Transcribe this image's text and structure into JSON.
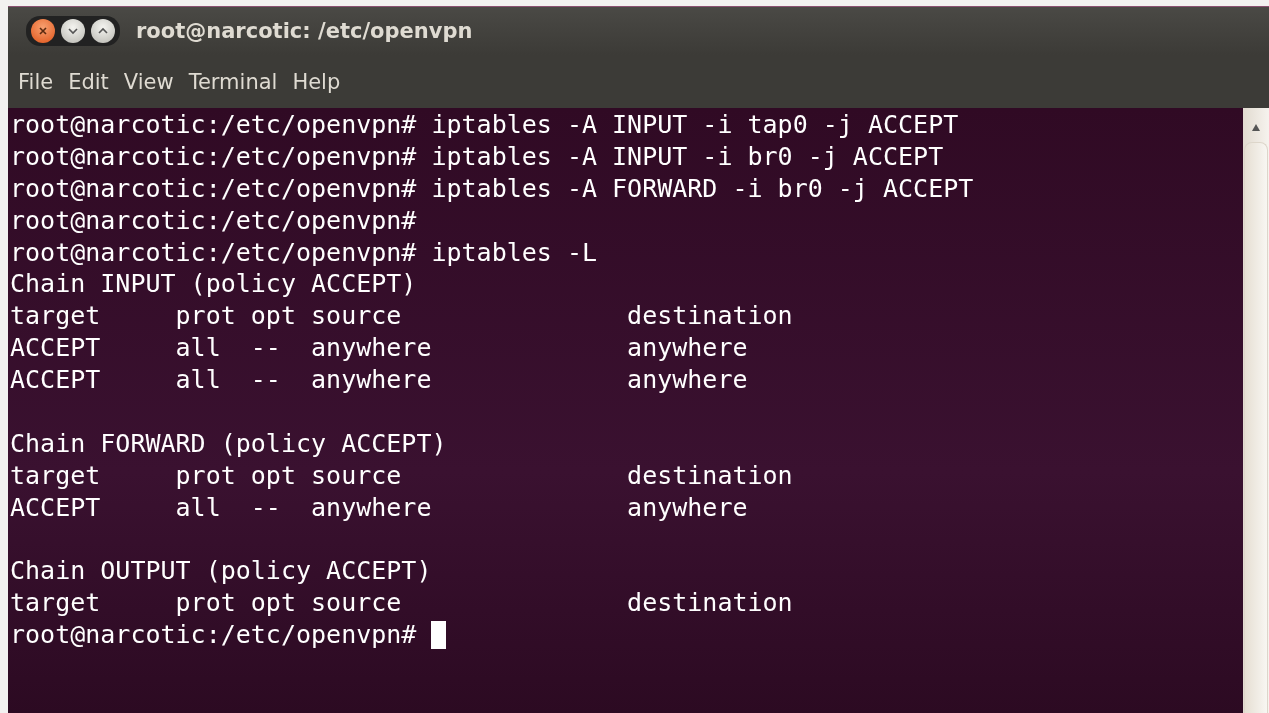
{
  "window": {
    "title": "root@narcotic: /etc/openvpn"
  },
  "menu": [
    "File",
    "Edit",
    "View",
    "Terminal",
    "Help"
  ],
  "terminal": {
    "lines": [
      {
        "kind": "text",
        "text": "root@narcotic:/etc/openvpn# iptables -A INPUT -i tap0 -j ACCEPT"
      },
      {
        "kind": "text",
        "text": "root@narcotic:/etc/openvpn# iptables -A INPUT -i br0 -j ACCEPT"
      },
      {
        "kind": "text",
        "text": "root@narcotic:/etc/openvpn# iptables -A FORWARD -i br0 -j ACCEPT"
      },
      {
        "kind": "text",
        "text": "root@narcotic:/etc/openvpn#"
      },
      {
        "kind": "text",
        "text": "root@narcotic:/etc/openvpn# iptables -L"
      },
      {
        "kind": "text",
        "text": "Chain INPUT (policy ACCEPT)"
      },
      {
        "kind": "text",
        "text": "target     prot opt source               destination"
      },
      {
        "kind": "text",
        "text": "ACCEPT     all  --  anywhere             anywhere"
      },
      {
        "kind": "text",
        "text": "ACCEPT     all  --  anywhere             anywhere"
      },
      {
        "kind": "blank"
      },
      {
        "kind": "text",
        "text": "Chain FORWARD (policy ACCEPT)"
      },
      {
        "kind": "text",
        "text": "target     prot opt source               destination"
      },
      {
        "kind": "text",
        "text": "ACCEPT     all  --  anywhere             anywhere"
      },
      {
        "kind": "blank"
      },
      {
        "kind": "text",
        "text": "Chain OUTPUT (policy ACCEPT)"
      },
      {
        "kind": "text",
        "text": "target     prot opt source               destination"
      },
      {
        "kind": "text",
        "text": "root@narcotic:/etc/openvpn#",
        "cursor": true
      }
    ]
  }
}
